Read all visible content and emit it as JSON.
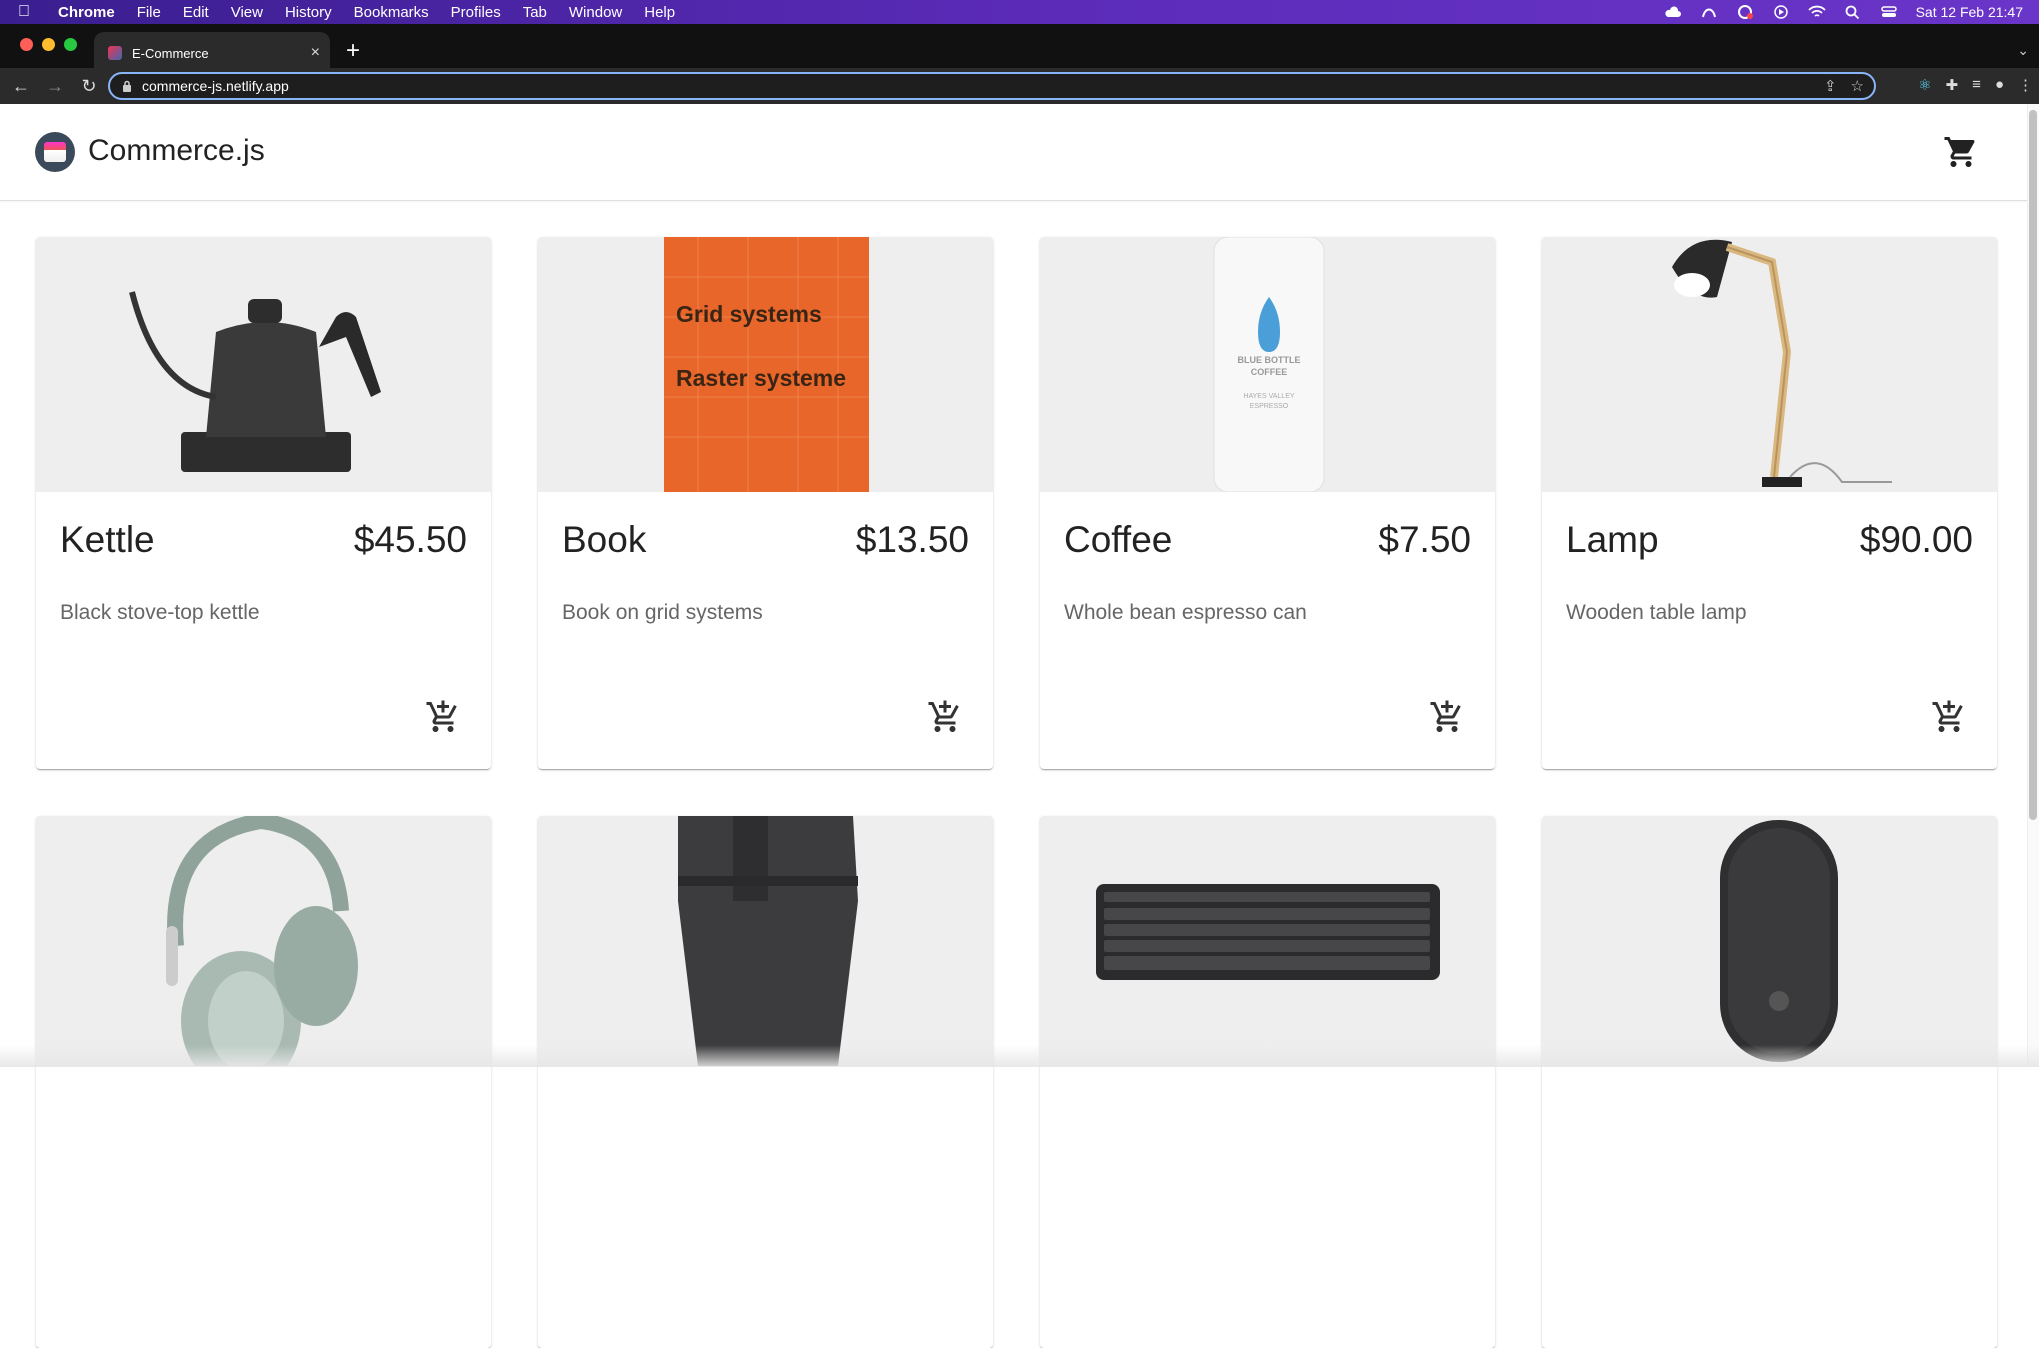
{
  "menubar": {
    "app": "Chrome",
    "items": [
      "File",
      "Edit",
      "View",
      "History",
      "Bookmarks",
      "Profiles",
      "Tab",
      "Window",
      "Help"
    ],
    "clock": "Sat 12 Feb  21:47"
  },
  "browser": {
    "tab_title": "E-Commerce",
    "url": "commerce-js.netlify.app"
  },
  "header": {
    "brand": "Commerce.js"
  },
  "products": [
    {
      "name": "Kettle",
      "price": "$45.50",
      "description": "Black stove-top kettle",
      "image_icon": "kettle-image"
    },
    {
      "name": "Book",
      "price": "$13.50",
      "description": "Book on grid systems",
      "image_icon": "book-image",
      "book_title_1": "Grid systems",
      "book_title_2": "Raster systeme"
    },
    {
      "name": "Coffee",
      "price": "$7.50",
      "description": "Whole bean espresso can",
      "image_icon": "coffee-can-image",
      "can_label_1": "BLUE BOTTLE",
      "can_label_2": "COFFEE",
      "can_label_3": "HAYES VALLEY",
      "can_label_4": "ESPRESSO"
    },
    {
      "name": "Lamp",
      "price": "$90.00",
      "description": "Wooden table lamp",
      "image_icon": "lamp-image"
    },
    {
      "image_icon": "headphones-image"
    },
    {
      "image_icon": "backpack-image"
    },
    {
      "image_icon": "keyboard-image"
    },
    {
      "image_icon": "mouse-image"
    }
  ],
  "colors": {
    "book_orange": "#e8662a",
    "menubar_purple": "#4a25a5",
    "focus_blue": "#8ab4f8"
  }
}
